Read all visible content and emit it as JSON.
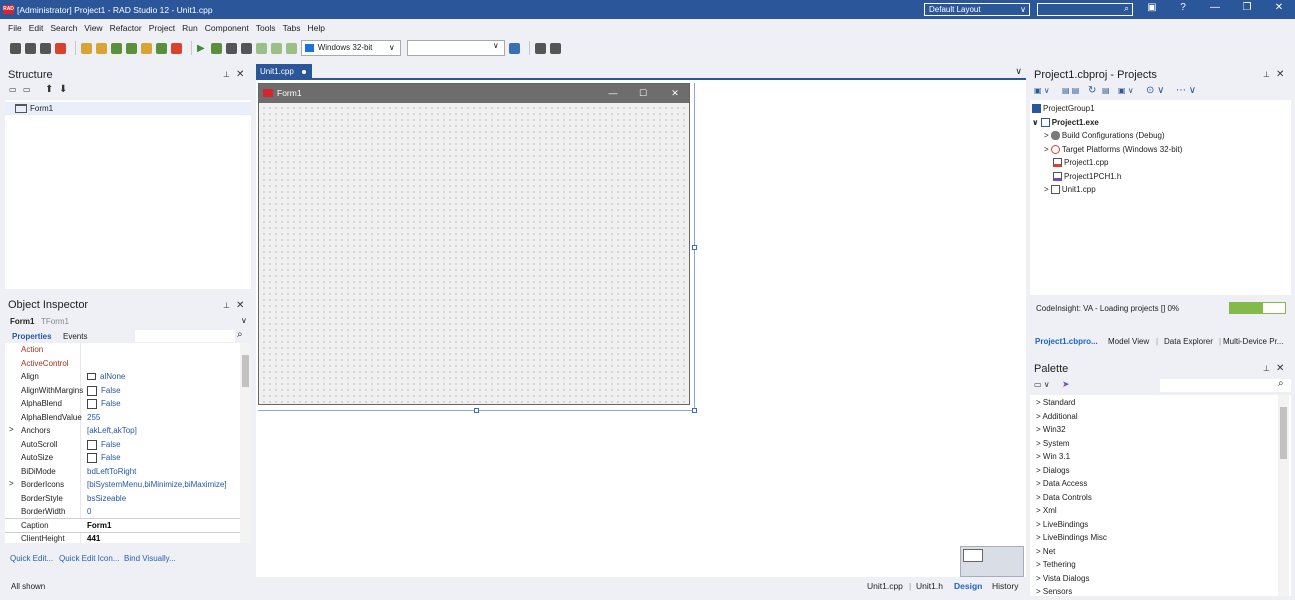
{
  "window": {
    "title": "[Administrator] Project1 - RAD Studio 12 - Unit1.cpp",
    "app_icon_text": "RAD",
    "layout_select": "Default Layout",
    "search_placeholder": "",
    "controls": [
      "?",
      "—",
      "❐",
      "✕"
    ]
  },
  "menu": [
    "File",
    "Edit",
    "Search",
    "View",
    "Refactor",
    "Project",
    "Run",
    "Component",
    "Tools",
    "Tabs",
    "Help"
  ],
  "toolbar": {
    "platform": "Windows 32-bit",
    "config": ""
  },
  "structure": {
    "title": "Structure",
    "nodes": [
      {
        "label": "Form1"
      }
    ]
  },
  "object_inspector": {
    "title": "Object Inspector",
    "object_name": "Form1",
    "object_type": "TForm1",
    "tabs": [
      "Properties",
      "Events"
    ],
    "properties": [
      {
        "name": "Action",
        "value": "",
        "kind": "event"
      },
      {
        "name": "ActiveControl",
        "value": "",
        "kind": "event"
      },
      {
        "name": "Align",
        "value": "alNone",
        "kind": "align"
      },
      {
        "name": "AlignWithMargins",
        "value": "False",
        "kind": "check"
      },
      {
        "name": "AlphaBlend",
        "value": "False",
        "kind": "check"
      },
      {
        "name": "AlphaBlendValue",
        "value": "255",
        "kind": "text"
      },
      {
        "name": "Anchors",
        "value": "[akLeft,akTop]",
        "kind": "expand"
      },
      {
        "name": "AutoScroll",
        "value": "False",
        "kind": "check"
      },
      {
        "name": "AutoSize",
        "value": "False",
        "kind": "check"
      },
      {
        "name": "BiDiMode",
        "value": "bdLeftToRight",
        "kind": "text"
      },
      {
        "name": "BorderIcons",
        "value": "[biSystemMenu,biMinimize,biMaximize]",
        "kind": "expand"
      },
      {
        "name": "BorderStyle",
        "value": "bsSizeable",
        "kind": "text"
      },
      {
        "name": "BorderWidth",
        "value": "0",
        "kind": "text"
      },
      {
        "name": "Caption",
        "value": "Form1",
        "kind": "bold"
      },
      {
        "name": "ClientHeight",
        "value": "441",
        "kind": "bold"
      }
    ],
    "quick_links": [
      "Quick Edit...",
      "Quick Edit Icon...",
      "Bind Visually..."
    ],
    "status": "All shown"
  },
  "editor": {
    "tab": "Unit1.cpp",
    "form_caption": "Form1",
    "bottom_tabs": [
      "Unit1.cpp",
      "Unit1.h",
      "Design",
      "History"
    ],
    "active_bottom_tab": "Design"
  },
  "projects": {
    "title": "Project1.cbproj - Projects",
    "tree": [
      {
        "label": "ProjectGroup1",
        "level": 0,
        "bold": false,
        "arrow": ""
      },
      {
        "label": "Project1.exe",
        "level": 0,
        "bold": true,
        "arrow": "∨"
      },
      {
        "label": "Build Configurations (Debug)",
        "level": 1,
        "bold": false,
        "arrow": ">"
      },
      {
        "label": "Target Platforms (Windows 32-bit)",
        "level": 1,
        "bold": false,
        "arrow": ">"
      },
      {
        "label": "Project1.cpp",
        "level": 2,
        "bold": false,
        "arrow": ""
      },
      {
        "label": "Project1PCH1.h",
        "level": 2,
        "bold": false,
        "arrow": ""
      },
      {
        "label": "Unit1.cpp",
        "level": 1,
        "bold": false,
        "arrow": ">"
      }
    ],
    "status": "CodeInsight: VA - Loading projects [] 0%",
    "progress_fraction": 0.6,
    "tabs": [
      "Project1.cbpro...",
      "Model View",
      "Data Explorer",
      "Multi-Device Pr..."
    ]
  },
  "palette": {
    "title": "Palette",
    "items": [
      "Standard",
      "Additional",
      "Win32",
      "System",
      "Win 3.1",
      "Dialogs",
      "Data Access",
      "Data Controls",
      "Xml",
      "LiveBindings",
      "LiveBindings Misc",
      "Net",
      "Tethering",
      "Vista Dialogs",
      "Sensors"
    ]
  },
  "colors": {
    "title_bar": "#2b579a",
    "accent": "#2b579a",
    "progress": "#86b94c",
    "event_prop": "#b0301b",
    "prop_value": "#2457a8"
  }
}
